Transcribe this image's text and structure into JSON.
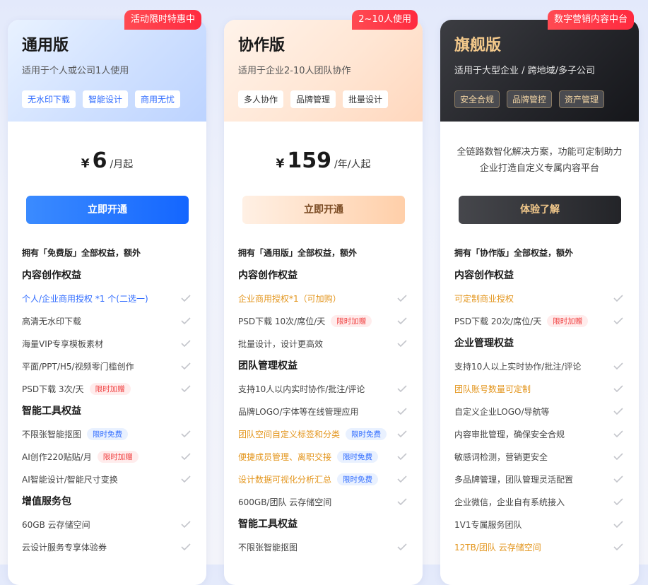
{
  "colors": {
    "accent_blue": "#2f6bff",
    "accent_orange": "#e3951c",
    "ribbon_red": "#ff3344",
    "dark_gold": "#f3c98b"
  },
  "plans": [
    {
      "ribbon": "活动限时特惠中",
      "title": "通用版",
      "subtitle": "适用于个人或公司1人使用",
      "tags": [
        "无水印下载",
        "智能设计",
        "商用无忧"
      ],
      "price": {
        "currency": "¥",
        "amount": "6",
        "unit": "/月起"
      },
      "button": "立即开通",
      "intro": "拥有「免费版」全部权益，额外",
      "groups": [
        {
          "title": "内容创作权益",
          "items": [
            {
              "text": "个人/企业商用授权 *1 个(二选一)",
              "color": "blue",
              "badge": "",
              "badge_color": ""
            },
            {
              "text": "高清无水印下载",
              "color": "",
              "badge": "",
              "badge_color": ""
            },
            {
              "text": "海量VIP专享模板素材",
              "color": "",
              "badge": "",
              "badge_color": ""
            },
            {
              "text": "平面/PPT/H5/视频零门槛创作",
              "color": "",
              "badge": "",
              "badge_color": ""
            },
            {
              "text": "PSD下载 3次/天",
              "color": "",
              "badge": "限时加赠",
              "badge_color": "red"
            }
          ]
        },
        {
          "title": "智能工具权益",
          "items": [
            {
              "text": "不限张智能抠图",
              "color": "",
              "badge": "限时免费",
              "badge_color": "blue"
            },
            {
              "text": "AI创作220贴贴/月",
              "color": "",
              "badge": "限时加赠",
              "badge_color": "red"
            },
            {
              "text": "AI智能设计/智能尺寸变换",
              "color": "",
              "badge": "",
              "badge_color": ""
            }
          ]
        },
        {
          "title": "增值服务包",
          "items": [
            {
              "text": "60GB 云存储空间",
              "color": "",
              "badge": "",
              "badge_color": ""
            },
            {
              "text": "云设计服务专享体验券",
              "color": "",
              "badge": "",
              "badge_color": ""
            }
          ]
        }
      ]
    },
    {
      "ribbon": "2~10人使用",
      "title": "协作版",
      "subtitle": "适用于企业2-10人团队协作",
      "tags": [
        "多人协作",
        "品牌管理",
        "批量设计"
      ],
      "price": {
        "currency": "¥",
        "amount": "159",
        "unit": "/年/人起"
      },
      "button": "立即开通",
      "intro": "拥有「通用版」全部权益，额外",
      "groups": [
        {
          "title": "内容创作权益",
          "items": [
            {
              "text": "企业商用授权*1（可加购）",
              "color": "orange",
              "badge": "",
              "badge_color": ""
            },
            {
              "text": "PSD下载 10次/席位/天",
              "color": "",
              "badge": "限时加赠",
              "badge_color": "red"
            },
            {
              "text": "批量设计，设计更高效",
              "color": "",
              "badge": "",
              "badge_color": ""
            }
          ]
        },
        {
          "title": "团队管理权益",
          "items": [
            {
              "text": "支持10人以内实时协作/批注/评论",
              "color": "",
              "badge": "",
              "badge_color": ""
            },
            {
              "text": "品牌LOGO/字体等在线管理应用",
              "color": "",
              "badge": "",
              "badge_color": ""
            },
            {
              "text": "团队空间自定义标签和分类",
              "color": "orange",
              "badge": "限时免费",
              "badge_color": "blue"
            },
            {
              "text": "便捷成员管理、离职交接",
              "color": "orange",
              "badge": "限时免费",
              "badge_color": "blue"
            },
            {
              "text": "设计数据可视化分析汇总",
              "color": "orange",
              "badge": "限时免费",
              "badge_color": "blue"
            },
            {
              "text": "600GB/团队 云存储空间",
              "color": "",
              "badge": "",
              "badge_color": ""
            }
          ]
        },
        {
          "title": "智能工具权益",
          "items": [
            {
              "text": "不限张智能抠图",
              "color": "",
              "badge": "",
              "badge_color": ""
            }
          ]
        }
      ]
    },
    {
      "ribbon": "数字营销内容中台",
      "title": "旗舰版",
      "subtitle": "适用于大型企业 / 跨地域/多子公司",
      "tags": [
        "安全合规",
        "品牌管控",
        "资产管理"
      ],
      "description": "全链路数智化解决方案，功能可定制助力企业打造自定义专属内容平台",
      "button": "体验了解",
      "intro": "拥有「协作版」全部权益，额外",
      "groups": [
        {
          "title": "内容创作权益",
          "items": [
            {
              "text": "可定制商业授权",
              "color": "orange",
              "badge": "",
              "badge_color": ""
            },
            {
              "text": "PSD下载 20次/席位/天",
              "color": "",
              "badge": "限时加赠",
              "badge_color": "red"
            }
          ]
        },
        {
          "title": "企业管理权益",
          "items": [
            {
              "text": "支持10人以上实时协作/批注/评论",
              "color": "",
              "badge": "",
              "badge_color": ""
            },
            {
              "text": "团队账号数量可定制",
              "color": "orange",
              "badge": "",
              "badge_color": ""
            },
            {
              "text": "自定义企业LOGO/导航等",
              "color": "",
              "badge": "",
              "badge_color": ""
            },
            {
              "text": "内容审批管理，确保安全合规",
              "color": "",
              "badge": "",
              "badge_color": ""
            },
            {
              "text": "敏感词检测，营销更安全",
              "color": "",
              "badge": "",
              "badge_color": ""
            },
            {
              "text": "多品牌管理，团队管理灵活配置",
              "color": "",
              "badge": "",
              "badge_color": ""
            },
            {
              "text": "企业微信，企业自有系统接入",
              "color": "",
              "badge": "",
              "badge_color": ""
            },
            {
              "text": "1V1专属服务团队",
              "color": "",
              "badge": "",
              "badge_color": ""
            },
            {
              "text": "12TB/团队 云存储空间",
              "color": "orange",
              "badge": "",
              "badge_color": ""
            }
          ]
        }
      ]
    }
  ]
}
